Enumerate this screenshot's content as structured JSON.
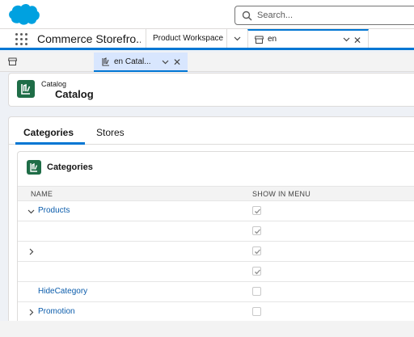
{
  "global_header": {
    "search_placeholder": "Search..."
  },
  "nav": {
    "app_name": "Commerce Storefro...",
    "tabs": [
      {
        "label": "Product Workspace"
      },
      {
        "label": "en"
      }
    ]
  },
  "subtabs": [
    {
      "label": "en Catal..."
    }
  ],
  "page_header": {
    "object_type": "Catalog",
    "title": "Catalog"
  },
  "main_tabs": [
    {
      "label": "Categories",
      "active": true
    },
    {
      "label": "Stores",
      "active": false
    }
  ],
  "categories_card": {
    "title": "Categories",
    "columns": [
      "NAME",
      "SHOW IN MENU"
    ],
    "rows": [
      {
        "name": "Products",
        "toggle": "expanded",
        "show_in_menu": true
      },
      {
        "name": "",
        "toggle": "none",
        "show_in_menu": true
      },
      {
        "name": "",
        "toggle": "collapsed",
        "show_in_menu": true
      },
      {
        "name": "",
        "toggle": "none",
        "show_in_menu": true
      },
      {
        "name": "HideCategory",
        "toggle": "none",
        "show_in_menu": false
      },
      {
        "name": "Promotion",
        "toggle": "collapsed",
        "show_in_menu": false
      }
    ]
  },
  "colors": {
    "brand_blue": "#0176d3",
    "link_blue": "#0b5cab",
    "catalog_green": "#1f6d47",
    "salesforce_cloud": "#00a1e0"
  }
}
